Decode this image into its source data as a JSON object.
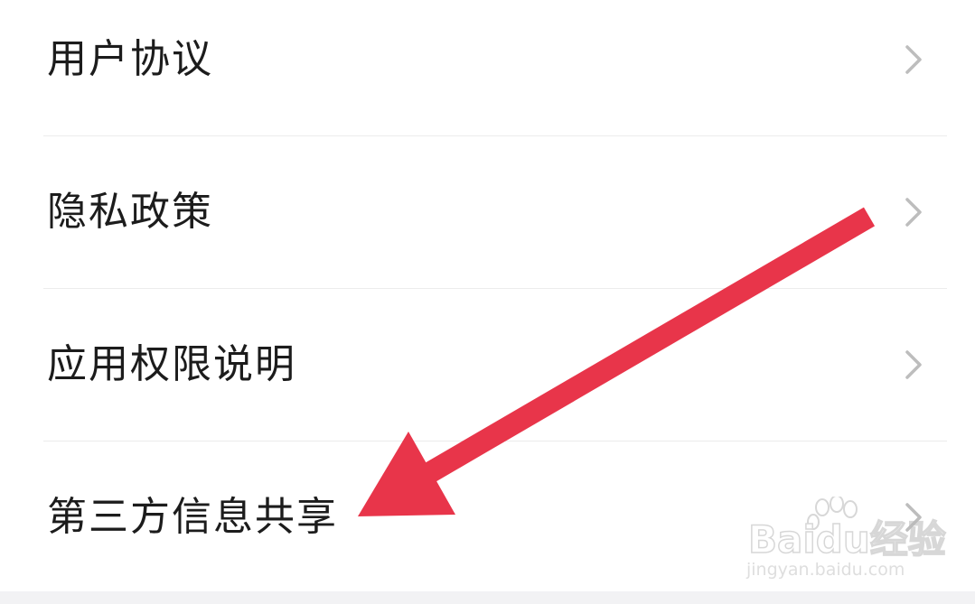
{
  "settings_list": {
    "items": [
      {
        "label": "用户协议"
      },
      {
        "label": "隐私政策"
      },
      {
        "label": "应用权限说明"
      },
      {
        "label": "第三方信息共享"
      }
    ]
  },
  "annotation": {
    "arrow_color": "#e8354a",
    "arrow_target": "第三方信息共享"
  },
  "watermark": {
    "logo_text": "Baidu经验",
    "url": "jingyan.baidu.com"
  },
  "colors": {
    "text": "#1c1c1c",
    "chevron": "#bdbdbd",
    "divider": "#ececec",
    "bottom_band": "#f2f2f4"
  },
  "icons": {
    "row_chevron": "chevron-right-icon"
  }
}
